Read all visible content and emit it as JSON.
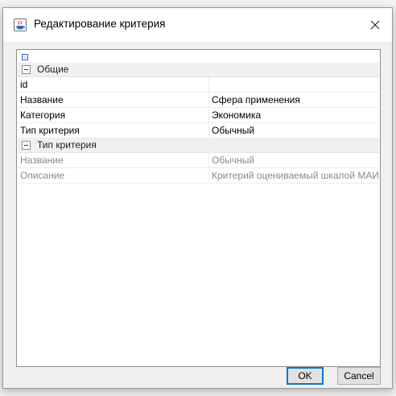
{
  "window": {
    "title": "Редактирование критерия",
    "app_icon": "java-app-icon",
    "close_icon": "close-icon"
  },
  "property_sheet": {
    "categories": [
      {
        "label": "Общие",
        "properties": [
          {
            "name": "id",
            "value": ""
          },
          {
            "name": "Название",
            "value": "Сфера применения"
          },
          {
            "name": "Категория",
            "value": "Экономика"
          },
          {
            "name": "Тип критерия",
            "value": "Обычный"
          }
        ]
      },
      {
        "label": "Тип критерия",
        "properties": [
          {
            "name": "Название",
            "value": "Обычный"
          },
          {
            "name": "Описание",
            "value": "Критерий оцениваемый шкалой МАИ"
          }
        ]
      }
    ]
  },
  "buttons": {
    "ok_label": "OK",
    "cancel_label": "Cancel"
  },
  "colors": {
    "accent": "#0078d7",
    "readonly_text": "#8a8a8a",
    "category_bg": "#f0f0f0"
  }
}
